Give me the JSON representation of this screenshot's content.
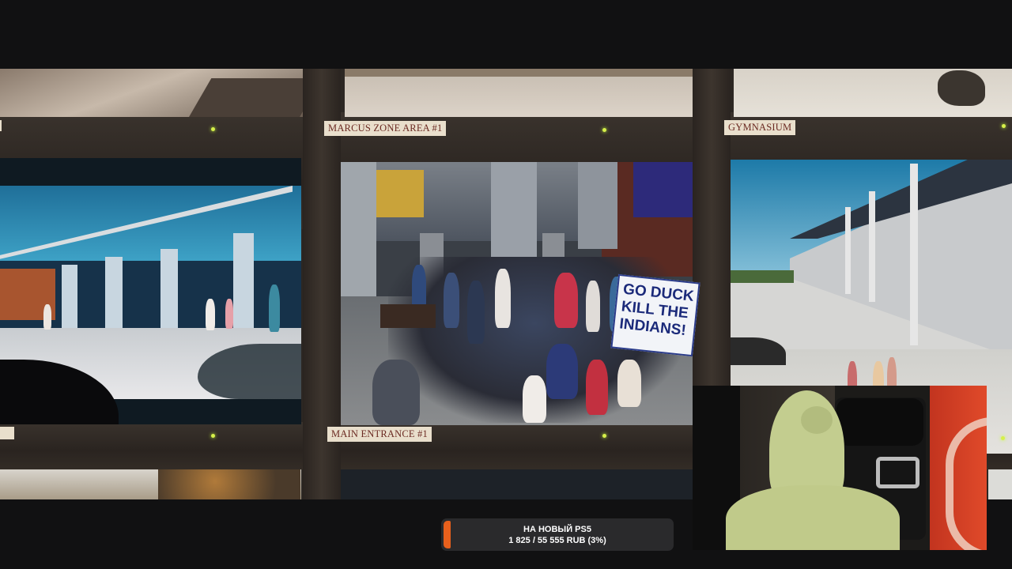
{
  "stream": {
    "camera_labels": {
      "top_middle": "MARCUS ZONE AREA #1",
      "top_right": "GYMNASIUM",
      "middle_middle": "MAIN ENTRANCE #1"
    },
    "crowd_sign": "GO DUCK\nKILL THE\nINDIANS!"
  },
  "donation_goal": {
    "title": "НА НОВЫЙ PS5",
    "progress_text": "1 825 / 55 555 RUB (3%)",
    "progress_fraction": 0.03,
    "bar_color": "#e8601c"
  },
  "webcam": {
    "avatar_icon": "green-frog-costume"
  },
  "colors": {
    "background": "#111112",
    "label_bg": "#e9dfcc",
    "label_text": "#6b2a22",
    "led": "#d6f04a"
  }
}
